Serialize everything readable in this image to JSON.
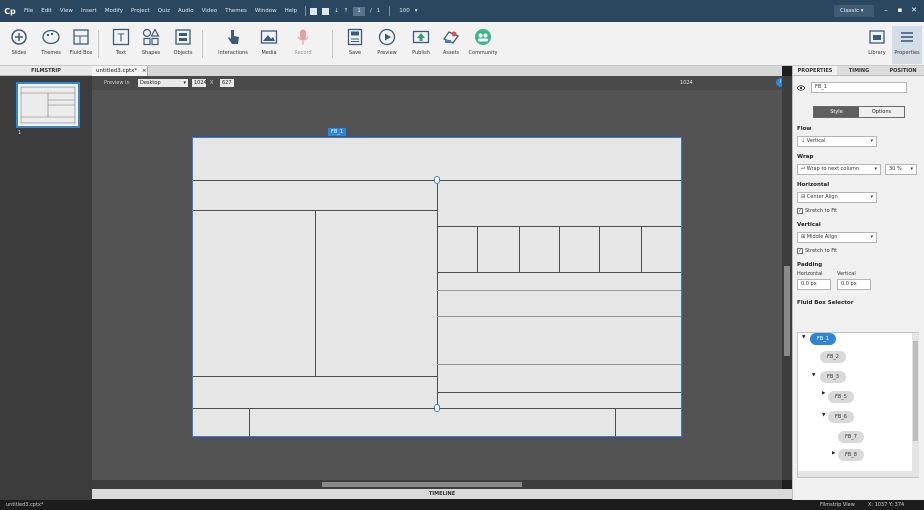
{
  "app": {
    "logo": "Cp",
    "workspace": "Classic"
  },
  "menu": [
    "File",
    "Edit",
    "View",
    "Insert",
    "Modify",
    "Project",
    "Quiz",
    "Audio",
    "Video",
    "Themes",
    "Window",
    "Help"
  ],
  "quick_access": {
    "slide_num": "1",
    "slide_total": "1",
    "zoom": "100"
  },
  "toolbar": {
    "slides": "Slides",
    "themes": "Themes",
    "fluid_box": "Fluid Box",
    "text": "Text",
    "shapes": "Shapes",
    "objects": "Objects",
    "interactions": "Interactions",
    "media": "Media",
    "record": "Record",
    "save": "Save",
    "preview": "Preview",
    "publish": "Publish",
    "assets": "Assets",
    "community": "Community",
    "library": "Library",
    "properties": "Properties"
  },
  "filmstrip": {
    "title": "FILMSTRIP",
    "slide_number": "1"
  },
  "document_tab": {
    "name": "untitled3.cptx*",
    "close": "×"
  },
  "preview_bar": {
    "label": "Preview in",
    "device": "Desktop",
    "width": "1024",
    "times": "X",
    "height": "627",
    "ruler_value": "1024"
  },
  "stage": {
    "fluid_box_tag": "FB_1"
  },
  "timeline": {
    "title": "TIMELINE"
  },
  "properties": {
    "tabs": [
      "PROPERTIES",
      "TIMING",
      "POSITION"
    ],
    "name_value": "FB_1",
    "seg_style": "Style",
    "seg_options": "Options",
    "flow_label": "Flow",
    "flow_value": "Vertical",
    "wrap_label": "Wrap",
    "wrap_value": "Wrap to next column",
    "wrap_percent": "30 %",
    "horizontal_label": "Horizontal",
    "horizontal_value": "Center Align",
    "stretch_h": "Stretch to Fit",
    "vertical_label": "Vertical",
    "vertical_value": "Middle Align",
    "stretch_v": "Stretch to Fit",
    "padding_label": "Padding",
    "padding_h_label": "Horizontal",
    "padding_v_label": "Vertical",
    "padding_h_value": "0.0",
    "padding_v_value": "0.0",
    "unit": "px",
    "selector_label": "Fluid Box Selector",
    "tree": [
      "FB_1",
      "FB_2",
      "FB_3",
      "FB_5",
      "FB_6",
      "FB_7",
      "FB_8"
    ]
  },
  "status": {
    "filename": "untitled3.cptx*",
    "view": "Filmstrip View",
    "coords": "X: 1037 Y: 374"
  },
  "colors": {
    "title_bar": "#2b4760",
    "accent": "#2f86d4",
    "stage": "#535353"
  }
}
